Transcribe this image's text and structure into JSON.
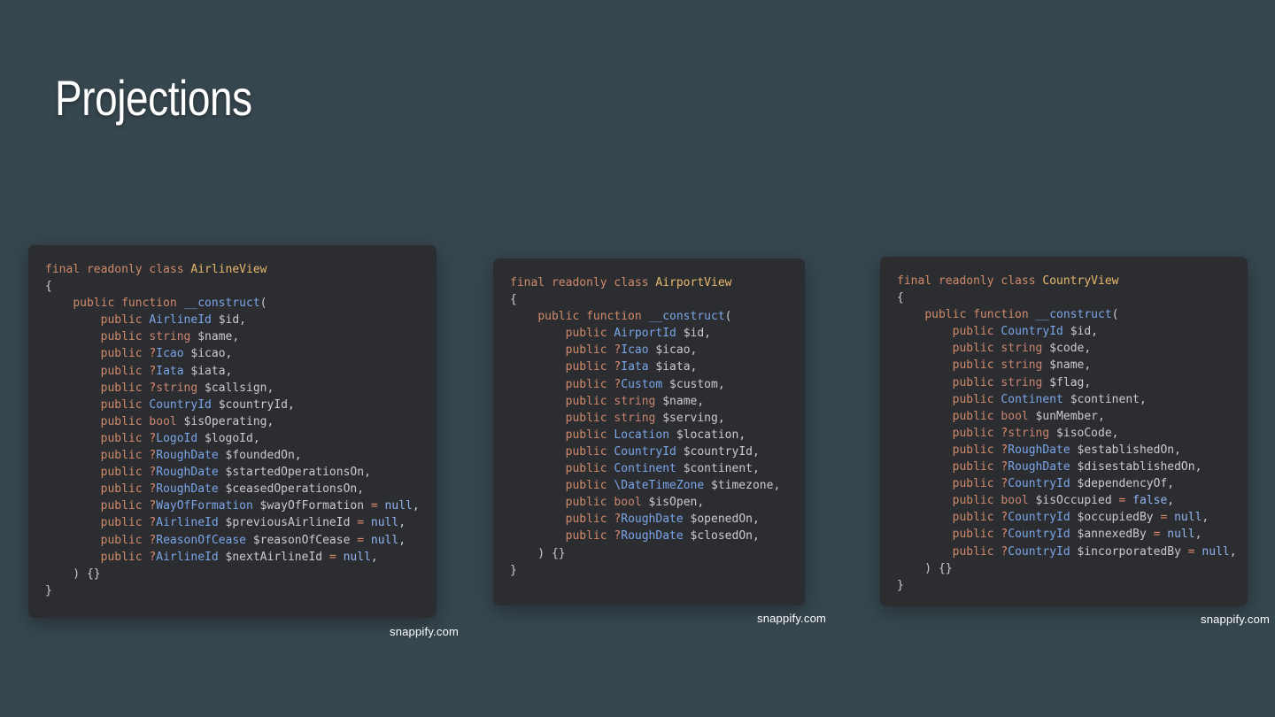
{
  "page": {
    "title": "Projections"
  },
  "colors": {
    "background": "#37474f",
    "card": "#2c2d31",
    "keyword": "#d08a6a",
    "class_name": "#e8b96c",
    "type": "#7aa5e8",
    "builtin_type": "#c98570",
    "variable": "#c9cbd0",
    "operator": "#e08a6c",
    "literal": "#8fb3ef"
  },
  "cards": [
    {
      "id": "airline",
      "credit": "snappify.com",
      "lines": [
        [
          {
            "t": "kw",
            "v": "final readonly class "
          },
          {
            "t": "cls",
            "v": "AirlineView"
          }
        ],
        [
          {
            "t": "p",
            "v": "{"
          }
        ],
        [
          {
            "t": "p",
            "v": "    "
          },
          {
            "t": "kw",
            "v": "public function "
          },
          {
            "t": "fn",
            "v": "__construct"
          },
          {
            "t": "p",
            "v": "("
          }
        ],
        [
          {
            "t": "p",
            "v": "        "
          },
          {
            "t": "kw",
            "v": "public "
          },
          {
            "t": "type",
            "v": "AirlineId"
          },
          {
            "t": "var",
            "v": " $id,"
          }
        ],
        [
          {
            "t": "p",
            "v": "        "
          },
          {
            "t": "kw",
            "v": "public "
          },
          {
            "t": "bi",
            "v": "string"
          },
          {
            "t": "var",
            "v": " $name,"
          }
        ],
        [
          {
            "t": "p",
            "v": "        "
          },
          {
            "t": "kw",
            "v": "public "
          },
          {
            "t": "op",
            "v": "?"
          },
          {
            "t": "type",
            "v": "Icao"
          },
          {
            "t": "var",
            "v": " $icao,"
          }
        ],
        [
          {
            "t": "p",
            "v": "        "
          },
          {
            "t": "kw",
            "v": "public "
          },
          {
            "t": "op",
            "v": "?"
          },
          {
            "t": "type",
            "v": "Iata"
          },
          {
            "t": "var",
            "v": " $iata,"
          }
        ],
        [
          {
            "t": "p",
            "v": "        "
          },
          {
            "t": "kw",
            "v": "public "
          },
          {
            "t": "op",
            "v": "?"
          },
          {
            "t": "bi",
            "v": "string"
          },
          {
            "t": "var",
            "v": " $callsign,"
          }
        ],
        [
          {
            "t": "p",
            "v": "        "
          },
          {
            "t": "kw",
            "v": "public "
          },
          {
            "t": "type",
            "v": "CountryId"
          },
          {
            "t": "var",
            "v": " $countryId,"
          }
        ],
        [
          {
            "t": "p",
            "v": "        "
          },
          {
            "t": "kw",
            "v": "public "
          },
          {
            "t": "bi",
            "v": "bool"
          },
          {
            "t": "var",
            "v": " $isOperating,"
          }
        ],
        [
          {
            "t": "p",
            "v": "        "
          },
          {
            "t": "kw",
            "v": "public "
          },
          {
            "t": "op",
            "v": "?"
          },
          {
            "t": "type",
            "v": "LogoId"
          },
          {
            "t": "var",
            "v": " $logoId,"
          }
        ],
        [
          {
            "t": "p",
            "v": "        "
          },
          {
            "t": "kw",
            "v": "public "
          },
          {
            "t": "op",
            "v": "?"
          },
          {
            "t": "type",
            "v": "RoughDate"
          },
          {
            "t": "var",
            "v": " $foundedOn,"
          }
        ],
        [
          {
            "t": "p",
            "v": "        "
          },
          {
            "t": "kw",
            "v": "public "
          },
          {
            "t": "op",
            "v": "?"
          },
          {
            "t": "type",
            "v": "RoughDate"
          },
          {
            "t": "var",
            "v": " $startedOperationsOn,"
          }
        ],
        [
          {
            "t": "p",
            "v": "        "
          },
          {
            "t": "kw",
            "v": "public "
          },
          {
            "t": "op",
            "v": "?"
          },
          {
            "t": "type",
            "v": "RoughDate"
          },
          {
            "t": "var",
            "v": " $ceasedOperationsOn,"
          }
        ],
        [
          {
            "t": "p",
            "v": "        "
          },
          {
            "t": "kw",
            "v": "public "
          },
          {
            "t": "op",
            "v": "?"
          },
          {
            "t": "type",
            "v": "WayOfFormation"
          },
          {
            "t": "var",
            "v": " $wayOfFormation "
          },
          {
            "t": "op",
            "v": "="
          },
          {
            "t": "lit",
            "v": " null"
          },
          {
            "t": "p",
            "v": ","
          }
        ],
        [
          {
            "t": "p",
            "v": "        "
          },
          {
            "t": "kw",
            "v": "public "
          },
          {
            "t": "op",
            "v": "?"
          },
          {
            "t": "type",
            "v": "AirlineId"
          },
          {
            "t": "var",
            "v": " $previousAirlineId "
          },
          {
            "t": "op",
            "v": "="
          },
          {
            "t": "lit",
            "v": " null"
          },
          {
            "t": "p",
            "v": ","
          }
        ],
        [
          {
            "t": "p",
            "v": "        "
          },
          {
            "t": "kw",
            "v": "public "
          },
          {
            "t": "op",
            "v": "?"
          },
          {
            "t": "type",
            "v": "ReasonOfCease"
          },
          {
            "t": "var",
            "v": " $reasonOfCease "
          },
          {
            "t": "op",
            "v": "="
          },
          {
            "t": "lit",
            "v": " null"
          },
          {
            "t": "p",
            "v": ","
          }
        ],
        [
          {
            "t": "p",
            "v": "        "
          },
          {
            "t": "kw",
            "v": "public "
          },
          {
            "t": "op",
            "v": "?"
          },
          {
            "t": "type",
            "v": "AirlineId"
          },
          {
            "t": "var",
            "v": " $nextAirlineId "
          },
          {
            "t": "op",
            "v": "="
          },
          {
            "t": "lit",
            "v": " null"
          },
          {
            "t": "p",
            "v": ","
          }
        ],
        [
          {
            "t": "p",
            "v": "    ) {}"
          }
        ],
        [
          {
            "t": "p",
            "v": "}"
          }
        ]
      ]
    },
    {
      "id": "airport",
      "credit": "snappify.com",
      "lines": [
        [
          {
            "t": "kw",
            "v": "final readonly class "
          },
          {
            "t": "cls",
            "v": "AirportView"
          }
        ],
        [
          {
            "t": "p",
            "v": "{"
          }
        ],
        [
          {
            "t": "p",
            "v": "    "
          },
          {
            "t": "kw",
            "v": "public function "
          },
          {
            "t": "fn",
            "v": "__construct"
          },
          {
            "t": "p",
            "v": "("
          }
        ],
        [
          {
            "t": "p",
            "v": "        "
          },
          {
            "t": "kw",
            "v": "public "
          },
          {
            "t": "type",
            "v": "AirportId"
          },
          {
            "t": "var",
            "v": " $id,"
          }
        ],
        [
          {
            "t": "p",
            "v": "        "
          },
          {
            "t": "kw",
            "v": "public "
          },
          {
            "t": "op",
            "v": "?"
          },
          {
            "t": "type",
            "v": "Icao"
          },
          {
            "t": "var",
            "v": " $icao,"
          }
        ],
        [
          {
            "t": "p",
            "v": "        "
          },
          {
            "t": "kw",
            "v": "public "
          },
          {
            "t": "op",
            "v": "?"
          },
          {
            "t": "type",
            "v": "Iata"
          },
          {
            "t": "var",
            "v": " $iata,"
          }
        ],
        [
          {
            "t": "p",
            "v": "        "
          },
          {
            "t": "kw",
            "v": "public "
          },
          {
            "t": "op",
            "v": "?"
          },
          {
            "t": "type",
            "v": "Custom"
          },
          {
            "t": "var",
            "v": " $custom,"
          }
        ],
        [
          {
            "t": "p",
            "v": "        "
          },
          {
            "t": "kw",
            "v": "public "
          },
          {
            "t": "bi",
            "v": "string"
          },
          {
            "t": "var",
            "v": " $name,"
          }
        ],
        [
          {
            "t": "p",
            "v": "        "
          },
          {
            "t": "kw",
            "v": "public "
          },
          {
            "t": "bi",
            "v": "string"
          },
          {
            "t": "var",
            "v": " $serving,"
          }
        ],
        [
          {
            "t": "p",
            "v": "        "
          },
          {
            "t": "kw",
            "v": "public "
          },
          {
            "t": "type",
            "v": "Location"
          },
          {
            "t": "var",
            "v": " $location,"
          }
        ],
        [
          {
            "t": "p",
            "v": "        "
          },
          {
            "t": "kw",
            "v": "public "
          },
          {
            "t": "type",
            "v": "CountryId"
          },
          {
            "t": "var",
            "v": " $countryId,"
          }
        ],
        [
          {
            "t": "p",
            "v": "        "
          },
          {
            "t": "kw",
            "v": "public "
          },
          {
            "t": "type",
            "v": "Continent"
          },
          {
            "t": "var",
            "v": " $continent,"
          }
        ],
        [
          {
            "t": "p",
            "v": "        "
          },
          {
            "t": "kw",
            "v": "public "
          },
          {
            "t": "type",
            "v": "\\DateTimeZone"
          },
          {
            "t": "var",
            "v": " $timezone,"
          }
        ],
        [
          {
            "t": "p",
            "v": "        "
          },
          {
            "t": "kw",
            "v": "public "
          },
          {
            "t": "bi",
            "v": "bool"
          },
          {
            "t": "var",
            "v": " $isOpen,"
          }
        ],
        [
          {
            "t": "p",
            "v": "        "
          },
          {
            "t": "kw",
            "v": "public "
          },
          {
            "t": "op",
            "v": "?"
          },
          {
            "t": "type",
            "v": "RoughDate"
          },
          {
            "t": "var",
            "v": " $openedOn,"
          }
        ],
        [
          {
            "t": "p",
            "v": "        "
          },
          {
            "t": "kw",
            "v": "public "
          },
          {
            "t": "op",
            "v": "?"
          },
          {
            "t": "type",
            "v": "RoughDate"
          },
          {
            "t": "var",
            "v": " $closedOn,"
          }
        ],
        [
          {
            "t": "p",
            "v": "    ) {}"
          }
        ],
        [
          {
            "t": "p",
            "v": "}"
          }
        ]
      ]
    },
    {
      "id": "country",
      "credit": "snappify.com",
      "lines": [
        [
          {
            "t": "kw",
            "v": "final readonly class "
          },
          {
            "t": "cls",
            "v": "CountryView"
          }
        ],
        [
          {
            "t": "p",
            "v": "{"
          }
        ],
        [
          {
            "t": "p",
            "v": "    "
          },
          {
            "t": "kw",
            "v": "public function "
          },
          {
            "t": "fn",
            "v": "__construct"
          },
          {
            "t": "p",
            "v": "("
          }
        ],
        [
          {
            "t": "p",
            "v": "        "
          },
          {
            "t": "kw",
            "v": "public "
          },
          {
            "t": "type",
            "v": "CountryId"
          },
          {
            "t": "var",
            "v": " $id,"
          }
        ],
        [
          {
            "t": "p",
            "v": "        "
          },
          {
            "t": "kw",
            "v": "public "
          },
          {
            "t": "bi",
            "v": "string"
          },
          {
            "t": "var",
            "v": " $code,"
          }
        ],
        [
          {
            "t": "p",
            "v": "        "
          },
          {
            "t": "kw",
            "v": "public "
          },
          {
            "t": "bi",
            "v": "string"
          },
          {
            "t": "var",
            "v": " $name,"
          }
        ],
        [
          {
            "t": "p",
            "v": "        "
          },
          {
            "t": "kw",
            "v": "public "
          },
          {
            "t": "bi",
            "v": "string"
          },
          {
            "t": "var",
            "v": " $flag,"
          }
        ],
        [
          {
            "t": "p",
            "v": "        "
          },
          {
            "t": "kw",
            "v": "public "
          },
          {
            "t": "type",
            "v": "Continent"
          },
          {
            "t": "var",
            "v": " $continent,"
          }
        ],
        [
          {
            "t": "p",
            "v": "        "
          },
          {
            "t": "kw",
            "v": "public "
          },
          {
            "t": "bi",
            "v": "bool"
          },
          {
            "t": "var",
            "v": " $unMember,"
          }
        ],
        [
          {
            "t": "p",
            "v": "        "
          },
          {
            "t": "kw",
            "v": "public "
          },
          {
            "t": "op",
            "v": "?"
          },
          {
            "t": "bi",
            "v": "string"
          },
          {
            "t": "var",
            "v": " $isoCode,"
          }
        ],
        [
          {
            "t": "p",
            "v": "        "
          },
          {
            "t": "kw",
            "v": "public "
          },
          {
            "t": "op",
            "v": "?"
          },
          {
            "t": "type",
            "v": "RoughDate"
          },
          {
            "t": "var",
            "v": " $establishedOn,"
          }
        ],
        [
          {
            "t": "p",
            "v": "        "
          },
          {
            "t": "kw",
            "v": "public "
          },
          {
            "t": "op",
            "v": "?"
          },
          {
            "t": "type",
            "v": "RoughDate"
          },
          {
            "t": "var",
            "v": " $disestablishedOn,"
          }
        ],
        [
          {
            "t": "p",
            "v": "        "
          },
          {
            "t": "kw",
            "v": "public "
          },
          {
            "t": "op",
            "v": "?"
          },
          {
            "t": "type",
            "v": "CountryId"
          },
          {
            "t": "var",
            "v": " $dependencyOf,"
          }
        ],
        [
          {
            "t": "p",
            "v": "        "
          },
          {
            "t": "kw",
            "v": "public "
          },
          {
            "t": "bi",
            "v": "bool"
          },
          {
            "t": "var",
            "v": " $isOccupied "
          },
          {
            "t": "op",
            "v": "="
          },
          {
            "t": "lit",
            "v": " false"
          },
          {
            "t": "p",
            "v": ","
          }
        ],
        [
          {
            "t": "p",
            "v": "        "
          },
          {
            "t": "kw",
            "v": "public "
          },
          {
            "t": "op",
            "v": "?"
          },
          {
            "t": "type",
            "v": "CountryId"
          },
          {
            "t": "var",
            "v": " $occupiedBy "
          },
          {
            "t": "op",
            "v": "="
          },
          {
            "t": "lit",
            "v": " null"
          },
          {
            "t": "p",
            "v": ","
          }
        ],
        [
          {
            "t": "p",
            "v": "        "
          },
          {
            "t": "kw",
            "v": "public "
          },
          {
            "t": "op",
            "v": "?"
          },
          {
            "t": "type",
            "v": "CountryId"
          },
          {
            "t": "var",
            "v": " $annexedBy "
          },
          {
            "t": "op",
            "v": "="
          },
          {
            "t": "lit",
            "v": " null"
          },
          {
            "t": "p",
            "v": ","
          }
        ],
        [
          {
            "t": "p",
            "v": "        "
          },
          {
            "t": "kw",
            "v": "public "
          },
          {
            "t": "op",
            "v": "?"
          },
          {
            "t": "type",
            "v": "CountryId"
          },
          {
            "t": "var",
            "v": " $incorporatedBy "
          },
          {
            "t": "op",
            "v": "="
          },
          {
            "t": "lit",
            "v": " null"
          },
          {
            "t": "p",
            "v": ","
          }
        ],
        [
          {
            "t": "p",
            "v": "    ) {}"
          }
        ],
        [
          {
            "t": "p",
            "v": "}"
          }
        ]
      ]
    }
  ]
}
